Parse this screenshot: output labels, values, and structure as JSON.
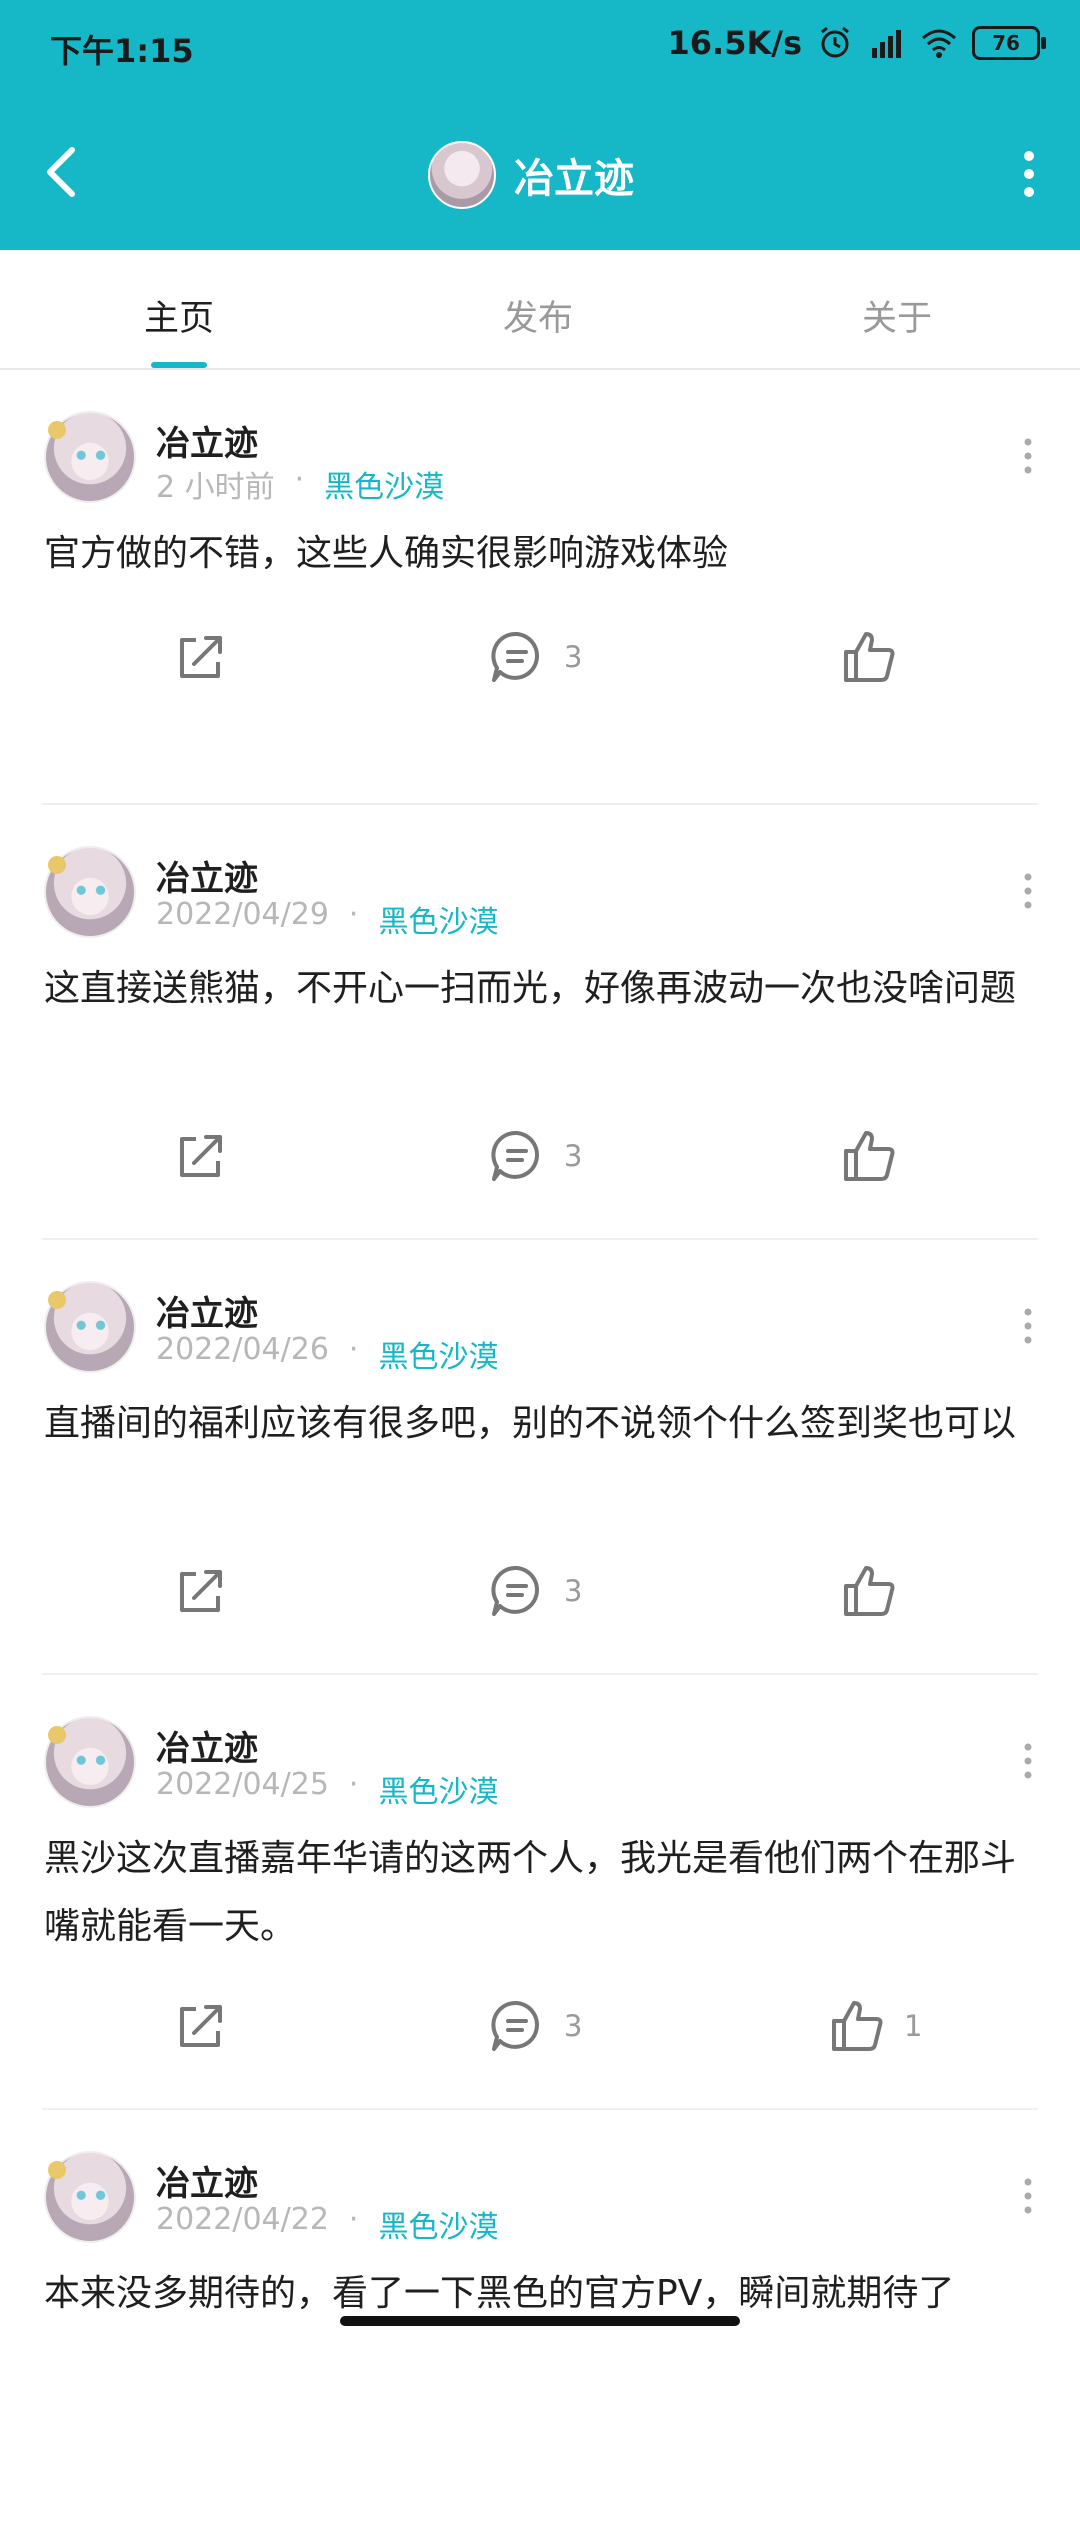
{
  "status_bar": {
    "time": "下午1:15",
    "network_speed": "16.5K/s",
    "battery": "76"
  },
  "header": {
    "title": "冶立迹"
  },
  "tabs": [
    {
      "label": "主页",
      "active": true
    },
    {
      "label": "发布",
      "active": false
    },
    {
      "label": "关于",
      "active": false
    }
  ],
  "posts": [
    {
      "author": "冶立迹",
      "time": "2 小时前",
      "separator": "·",
      "tag": "黑色沙漠",
      "text": "官方做的不错，这些人确实很影响游戏体验",
      "comments": "3",
      "likes": ""
    },
    {
      "author": "冶立迹",
      "time": "2022/04/29",
      "separator": "·",
      "tag": "黑色沙漠",
      "text": "这直接送熊猫，不开心一扫而光，好像再波动一次也没啥问题",
      "comments": "3",
      "likes": ""
    },
    {
      "author": "冶立迹",
      "time": "2022/04/26",
      "separator": "·",
      "tag": "黑色沙漠",
      "text": "直播间的福利应该有很多吧，别的不说领个什么签到奖也可以",
      "comments": "3",
      "likes": ""
    },
    {
      "author": "冶立迹",
      "time": "2022/04/25",
      "separator": "·",
      "tag": "黑色沙漠",
      "text": "黑沙这次直播嘉年华请的这两个人，我光是看他们两个在那斗嘴就能看一天。",
      "comments": "3",
      "likes": "1"
    },
    {
      "author": "冶立迹",
      "time": "2022/04/22",
      "separator": "·",
      "tag": "黑色沙漠",
      "text": "本来没多期待的，看了一下黑色的官方PV，瞬间就期待了",
      "comments": "",
      "likes": ""
    }
  ],
  "colors": {
    "accent": "#16b8c8",
    "meta": "#b7b7b7"
  }
}
